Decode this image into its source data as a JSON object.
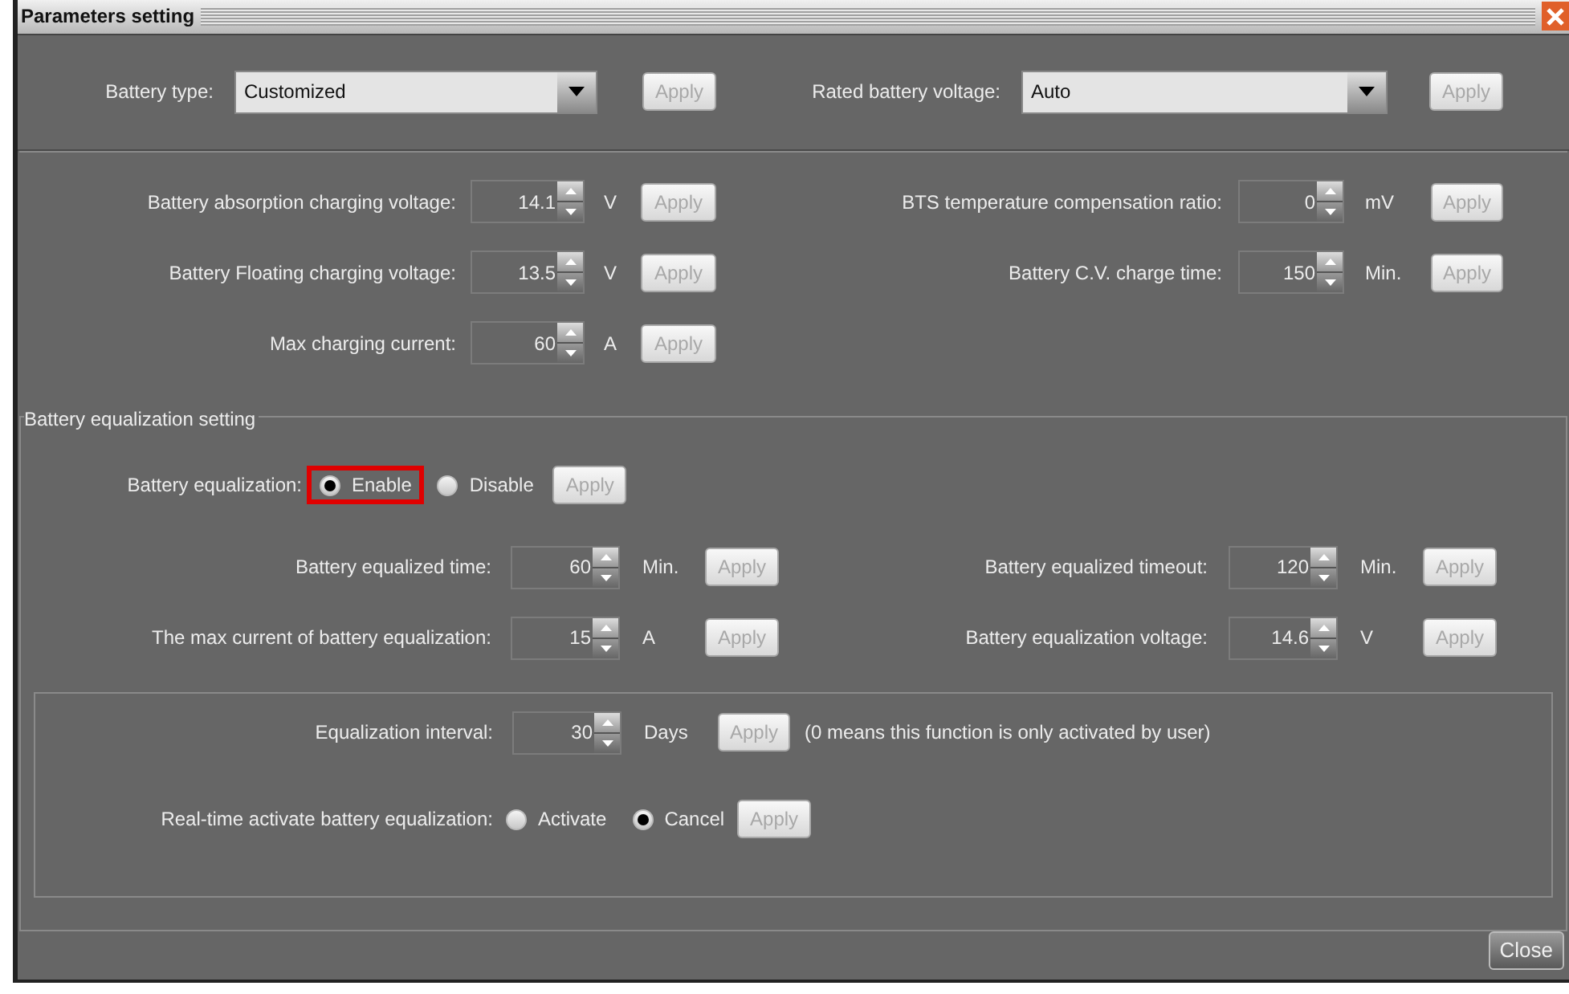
{
  "window": {
    "title": "Parameters setting"
  },
  "battery_selects": [
    {
      "label": "Battery type:",
      "value": "Customized",
      "button": "Apply"
    },
    {
      "label": "Rated battery voltage:",
      "value": "Auto",
      "button": "Apply"
    }
  ],
  "charging_rows": [
    [
      {
        "label": "Battery absorption charging voltage:",
        "value": "14.1",
        "unit": "V",
        "button": "Apply"
      },
      {
        "label": "BTS temperature compensation ratio:",
        "value": "0",
        "unit": "mV",
        "button": "Apply"
      }
    ],
    [
      {
        "label": "Battery Floating charging voltage:",
        "value": "13.5",
        "unit": "V",
        "button": "Apply"
      },
      {
        "label": "Battery C.V. charge time:",
        "value": "150",
        "unit": "Min.",
        "button": "Apply"
      }
    ],
    [
      {
        "label": "Max charging current:",
        "value": "60",
        "unit": "A",
        "button": "Apply"
      }
    ]
  ],
  "equalization": {
    "title": "Battery equalization setting",
    "mode": {
      "label": "Battery equalization:",
      "options": [
        {
          "label": "Enable",
          "selected": true,
          "highlighted": true
        },
        {
          "label": "Disable",
          "selected": false,
          "highlighted": false
        }
      ],
      "button": "Apply"
    },
    "rows": [
      [
        {
          "label": "Battery equalized time:",
          "value": "60",
          "unit": "Min.",
          "button": "Apply"
        },
        {
          "label": "Battery equalized timeout:",
          "value": "120",
          "unit": "Min.",
          "button": "Apply"
        }
      ],
      [
        {
          "label": "The max current of battery equalization:",
          "value": "15",
          "unit": "A",
          "button": "Apply"
        },
        {
          "label": "Battery equalization voltage:",
          "value": "14.6",
          "unit": "V",
          "button": "Apply"
        }
      ]
    ],
    "interval": {
      "label": "Equalization interval:",
      "value": "30",
      "unit": "Days",
      "button": "Apply",
      "note": "(0 means this function is only activated by user)"
    },
    "realtime": {
      "label": "Real-time activate battery equalization:",
      "options": [
        {
          "label": "Activate",
          "selected": false,
          "highlighted": false
        },
        {
          "label": "Cancel",
          "selected": true,
          "highlighted": false
        }
      ],
      "button": "Apply"
    }
  },
  "close_button": "Close"
}
